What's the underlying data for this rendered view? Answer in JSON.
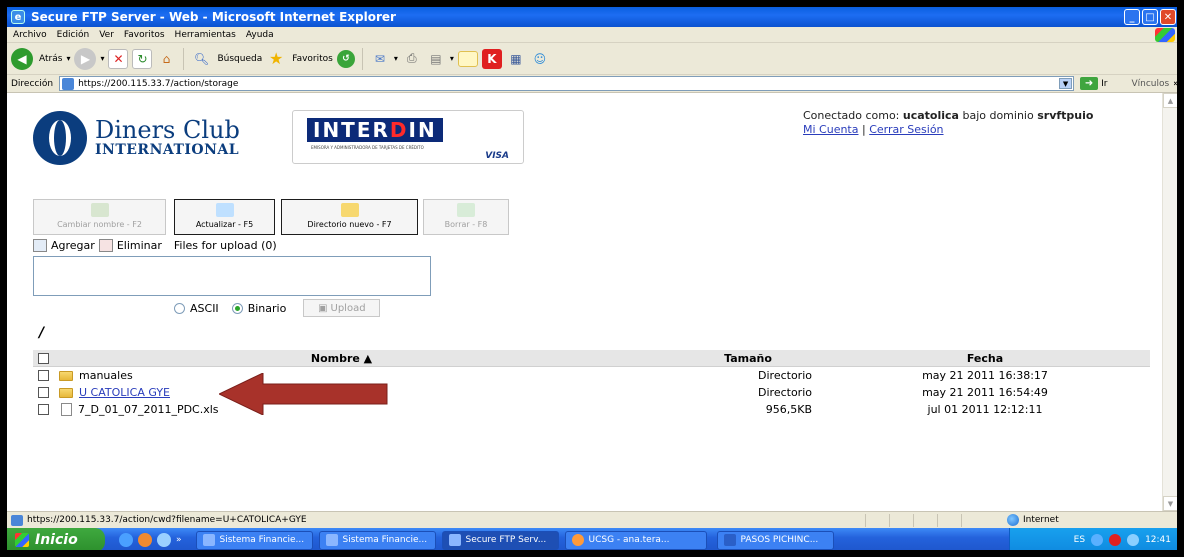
{
  "window": {
    "title": "Secure FTP Server - Web - Microsoft Internet Explorer"
  },
  "menu": [
    "Archivo",
    "Edición",
    "Ver",
    "Favoritos",
    "Herramientas",
    "Ayuda"
  ],
  "toolbar": {
    "back_label": "Atrás",
    "search_label": "Búsqueda",
    "favorites_label": "Favoritos"
  },
  "address": {
    "label": "Dirección",
    "url": "https://200.115.33.7/action/storage",
    "go_label": "Ir",
    "links_label": "Vínculos"
  },
  "logos": {
    "diners_line1": "Diners Club",
    "diners_line2": "INTERNATIONAL",
    "interdin_a": "INTER",
    "interdin_b": "D",
    "interdin_c": "IN",
    "interdin_sub": "EMISORA Y ADMINISTRADORA DE TARJETAS DE CRÉDITO",
    "interdin_visa": "VISA"
  },
  "session": {
    "prefix": "Conectado como:",
    "user": "ucatolica",
    "mid": "bajo dominio",
    "domain": "srvftpuio",
    "account_link": "Mi Cuenta",
    "separator": "|",
    "logout_link": "Cerrar Sesión"
  },
  "actions": {
    "rename": "Cambiar nombre - F2",
    "refresh": "Actualizar - F5",
    "newdir": "Directorio nuevo - F7",
    "delete": "Borrar - F8"
  },
  "upload": {
    "add": "Agregar",
    "remove": "Eliminar",
    "files_label": "Files for upload (0)",
    "ascii": "ASCII",
    "binary": "Binario",
    "mode_selected": "Binario",
    "upload_btn": "Upload"
  },
  "table": {
    "headers": {
      "name": "Nombre ▲",
      "size": "Tamaño",
      "date": "Fecha"
    },
    "rows": [
      {
        "name": "manuales",
        "type": "folder",
        "size": "Directorio",
        "date": "may 21 2011 16:38:17",
        "link": false
      },
      {
        "name": "U CATOLICA GYE",
        "type": "folder",
        "size": "Directorio",
        "date": "may 21 2011 16:54:49",
        "link": true
      },
      {
        "name": "7_D_01_07_2011_PDC.xls",
        "type": "file",
        "size": "956,5KB",
        "date": "jul 01 2011 12:12:11",
        "link": false
      }
    ]
  },
  "status": {
    "url": "https://200.115.33.7/action/cwd?filename=U+CATOLICA+GYE",
    "zone": "Internet"
  },
  "taskbar": {
    "start": "Inicio",
    "tasks": [
      "Sistema Financie...",
      "Sistema Financie...",
      "Secure FTP Serv...",
      "UCSG - ana.tera...",
      "PASOS PICHINC..."
    ],
    "lang": "ES",
    "clock": "12:41"
  },
  "colors": {
    "arrow": "#a8322a",
    "link": "#2a3dbb",
    "diners_blue": "#0b3d7e"
  }
}
